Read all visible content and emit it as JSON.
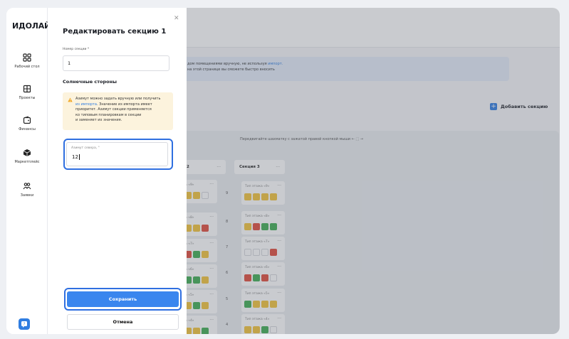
{
  "app": {
    "logo": "ИДОЛАЙТ"
  },
  "sidebar": {
    "items": [
      {
        "label": "Рабочий стол",
        "icon": "dashboard-icon"
      },
      {
        "label": "Проекты",
        "icon": "building-icon"
      },
      {
        "label": "Финансы",
        "icon": "wallet-icon"
      },
      {
        "label": "Маркетплейс",
        "icon": "cube-icon"
      },
      {
        "label": "Заявки",
        "icon": "people-icon"
      }
    ],
    "help_icon": "chat-help-icon"
  },
  "background": {
    "info_line1_pre": "дом помещениями вручную, не используя ",
    "info_line1_link": "импорт.",
    "info_line2": "на этой странице вы сможете быстро вносить",
    "add_section_label": "Добавить секцию",
    "drag_hint": "Передвигайте шахматку с зажатой правой кнопкой мыши ← ⬚ →",
    "section_2_label": "2",
    "section_3_label": "Секция 3",
    "floor_numbers": [
      "9",
      "8",
      "7",
      "6",
      "5",
      "4"
    ],
    "unit_type_labels": [
      "Тип этажа «9»",
      "Тип этажа «8»",
      "Тип этажа «7»",
      "Тип этажа «6»",
      "Тип этажа «5»",
      "Тип этажа «4»"
    ],
    "section_2_partial_labels": [
      "а «9»",
      "а «8»",
      "а «7»",
      "а «6»",
      "а «5»",
      "а «4»"
    ]
  },
  "modal": {
    "title": "Редактировать секцию 1",
    "section_number_label": "Номер секции *",
    "section_number_value": "1",
    "sides_heading": "Солнечные стороны",
    "warning_lines": [
      {
        "text": "Азимут можно задать вручную или получить"
      },
      {
        "link": "из импорта",
        "text": ". Значение из импорта имеет"
      },
      {
        "text": "приоритет. Азимут секции применяется"
      },
      {
        "text": "ко типовым планировкам в секции"
      },
      {
        "text": "и заменяет их значения."
      }
    ],
    "azimuth_label": "Азимут севера, °",
    "azimuth_value": "12",
    "save_label": "Сохранить",
    "cancel_label": "Отмена"
  },
  "colors": {
    "accent": "#3a86ee",
    "focus_ring": "#2f6fe0",
    "warning_bg": "#fcf3dd",
    "cell_yellow": "#f3c33a",
    "cell_red": "#e14b3b",
    "cell_green": "#3fae52"
  }
}
